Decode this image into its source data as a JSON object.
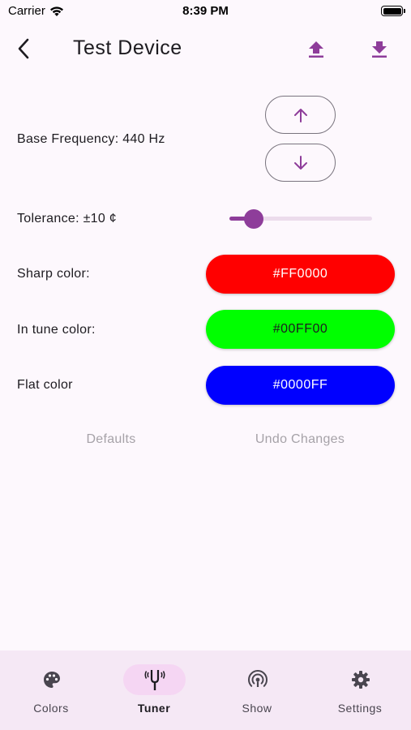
{
  "status_bar": {
    "carrier": "Carrier",
    "time": "8:39 PM"
  },
  "app_bar": {
    "title": "Test Device",
    "back_icon": "back-chevron-icon",
    "upload_icon": "upload-icon",
    "download_icon": "download-icon"
  },
  "settings": {
    "base_frequency_label": "Base Frequency: 440 Hz",
    "tolerance_label": "Tolerance: ±10 ¢",
    "tolerance_fraction": 0.17,
    "sharp_label": "Sharp color:",
    "sharp_value": "#FF0000",
    "in_tune_label": "In tune color:",
    "in_tune_value": "#00FF00",
    "flat_label": "Flat color",
    "flat_value": "#0000FF"
  },
  "actions": {
    "defaults": "Defaults",
    "undo": "Undo Changes"
  },
  "colors": {
    "accent": "#8e3d9a",
    "sharp": "#FF0000",
    "in_tune": "#00FF00",
    "flat": "#0000FF",
    "nav_bg": "#f5e8f5",
    "nav_active_pill": "#f5d6f3"
  },
  "bottom_nav": {
    "items": [
      {
        "label": "Colors",
        "icon": "palette-icon",
        "active": false
      },
      {
        "label": "Tuner",
        "icon": "tuning-fork-icon",
        "active": true
      },
      {
        "label": "Show",
        "icon": "broadcast-icon",
        "active": false
      },
      {
        "label": "Settings",
        "icon": "gear-icon",
        "active": false
      }
    ]
  }
}
